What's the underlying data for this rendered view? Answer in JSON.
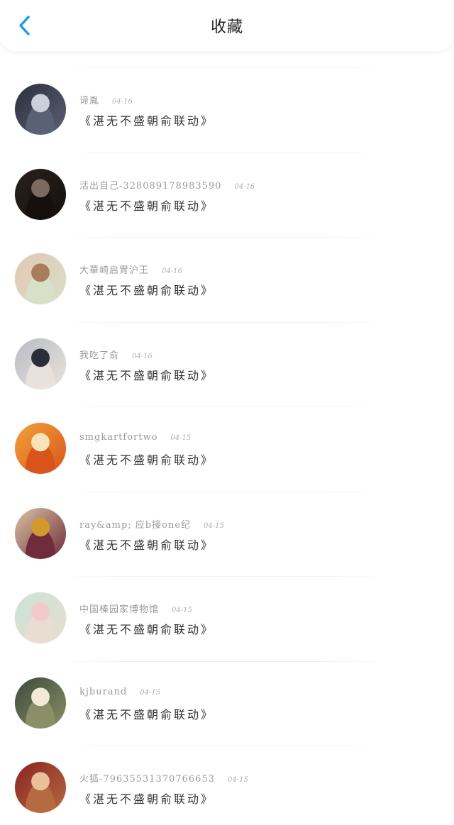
{
  "header": {
    "title": "收藏",
    "back_icon": "chevron-left-icon",
    "accent": "#1e9bf0"
  },
  "items": [
    {
      "name": "谛胤",
      "date": "04-16",
      "content": "《湛无不盛朝俞联动》",
      "avatar_colors": [
        "#2c2f3a",
        "#c9d0dc",
        "#5a6075"
      ]
    },
    {
      "name": "活出自己-328089178983590",
      "date": "04-16",
      "content": "《湛无不盛朝俞联动》",
      "avatar_colors": [
        "#2a201c",
        "#7a6a5f",
        "#15100e"
      ]
    },
    {
      "name": "大華崎启胃沪王",
      "date": "04-16",
      "content": "《湛无不盛朝俞联动》",
      "avatar_colors": [
        "#e3c7b3",
        "#a97d5b",
        "#d8e0c8"
      ]
    },
    {
      "name": "我吃了俞",
      "date": "04-16",
      "content": "《湛无不盛朝俞联动》",
      "avatar_colors": [
        "#b9bcc4",
        "#2a2e38",
        "#e9e2dc"
      ]
    },
    {
      "name": "smgkartfortwo",
      "date": "04-15",
      "content": "《湛无不盛朝俞联动》",
      "avatar_colors": [
        "#f2a33a",
        "#f7e3b8",
        "#d8541b"
      ]
    },
    {
      "name": "ray&amp; 应b接one纪",
      "date": "04-15",
      "content": "《湛无不盛朝俞联动》",
      "avatar_colors": [
        "#d9c3a3",
        "#d29a2b",
        "#6e2c3c"
      ]
    },
    {
      "name": "中国榛园家博物馆",
      "date": "04-15",
      "content": "《湛无不盛朝俞联动》",
      "avatar_colors": [
        "#c9e3d6",
        "#f0c9c9",
        "#e8ddd0"
      ]
    },
    {
      "name": "kjburand",
      "date": "04-15",
      "content": "《湛无不盛朝俞联动》",
      "avatar_colors": [
        "#3d4a3a",
        "#f0ead6",
        "#8a8f68"
      ]
    },
    {
      "name": "火狐-79635531370766653",
      "date": "04-15",
      "content": "《湛无不盛朝俞联动》",
      "avatar_colors": [
        "#8a2320",
        "#e8c09a",
        "#b56a42"
      ]
    }
  ]
}
